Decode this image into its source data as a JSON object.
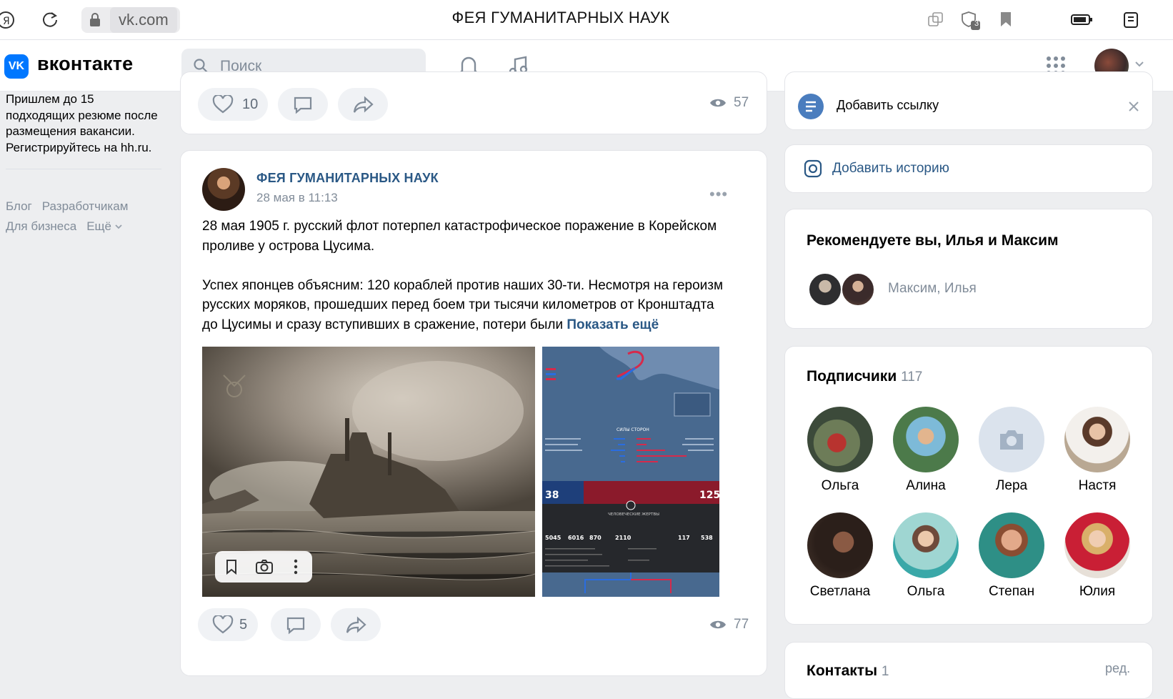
{
  "browser": {
    "url": "vk.com",
    "title": "ФЕЯ ГУМАНИТАРНЫХ НАУК",
    "tabs_badge": "3"
  },
  "header": {
    "brand": "вконтакте",
    "logo_text": "VK",
    "search_placeholder": "Поиск"
  },
  "left": {
    "ad_text": "Пришлем до 15 подходящих резюме после размещения вакансии. Регистрируйтесь на hh.ru.",
    "footer_links": [
      "Блог",
      "Разработчикам",
      "Для бизнеса",
      "Ещё"
    ]
  },
  "prev_post": {
    "likes": "10",
    "views": "57"
  },
  "post": {
    "author": "ФЕЯ ГУМАНИТАРНЫХ НАУК",
    "date": "28 мая в 11:13",
    "more": "•••",
    "paragraph1": "28 мая 1905 г. русский флот потерпел катастрофическое поражение в Корейском проливе у острова Цусима.",
    "paragraph2": "Успех японцев объясним: 120 кораблей против наших 30-ти. Несмотря на героизм русских моряков, прошедших перед боем три тысячи километров от Кронштадта до Цусимы и сразу вступивших в сражение, потери были",
    "show_more": "Показать ещё",
    "likes": "5",
    "views": "77",
    "infographic": {
      "section1": "СИЛЫ СТОРОН",
      "left_num": "38",
      "right_num": "125",
      "section2": "ЧЕЛОВЕЧЕСКИЕ ЖЕРТВЫ",
      "stats": [
        "5045",
        "6016",
        "870",
        "2110",
        "117",
        "538"
      ]
    }
  },
  "right": {
    "add_link": "Добавить ссылку",
    "add_story": "Добавить историю",
    "recommend_title": "Рекомендуете вы, Илья и Максим",
    "recommend_names": "Максим, Илья",
    "subscribers_title": "Подписчики",
    "subscribers_count": "117",
    "subscribers": [
      {
        "name": "Ольга"
      },
      {
        "name": "Алина"
      },
      {
        "name": "Лера"
      },
      {
        "name": "Настя"
      },
      {
        "name": "Светлана"
      },
      {
        "name": "Ольга"
      },
      {
        "name": "Степан"
      },
      {
        "name": "Юлия"
      }
    ],
    "contacts_title": "Контакты",
    "contacts_count": "1",
    "contacts_edit": "ред."
  }
}
